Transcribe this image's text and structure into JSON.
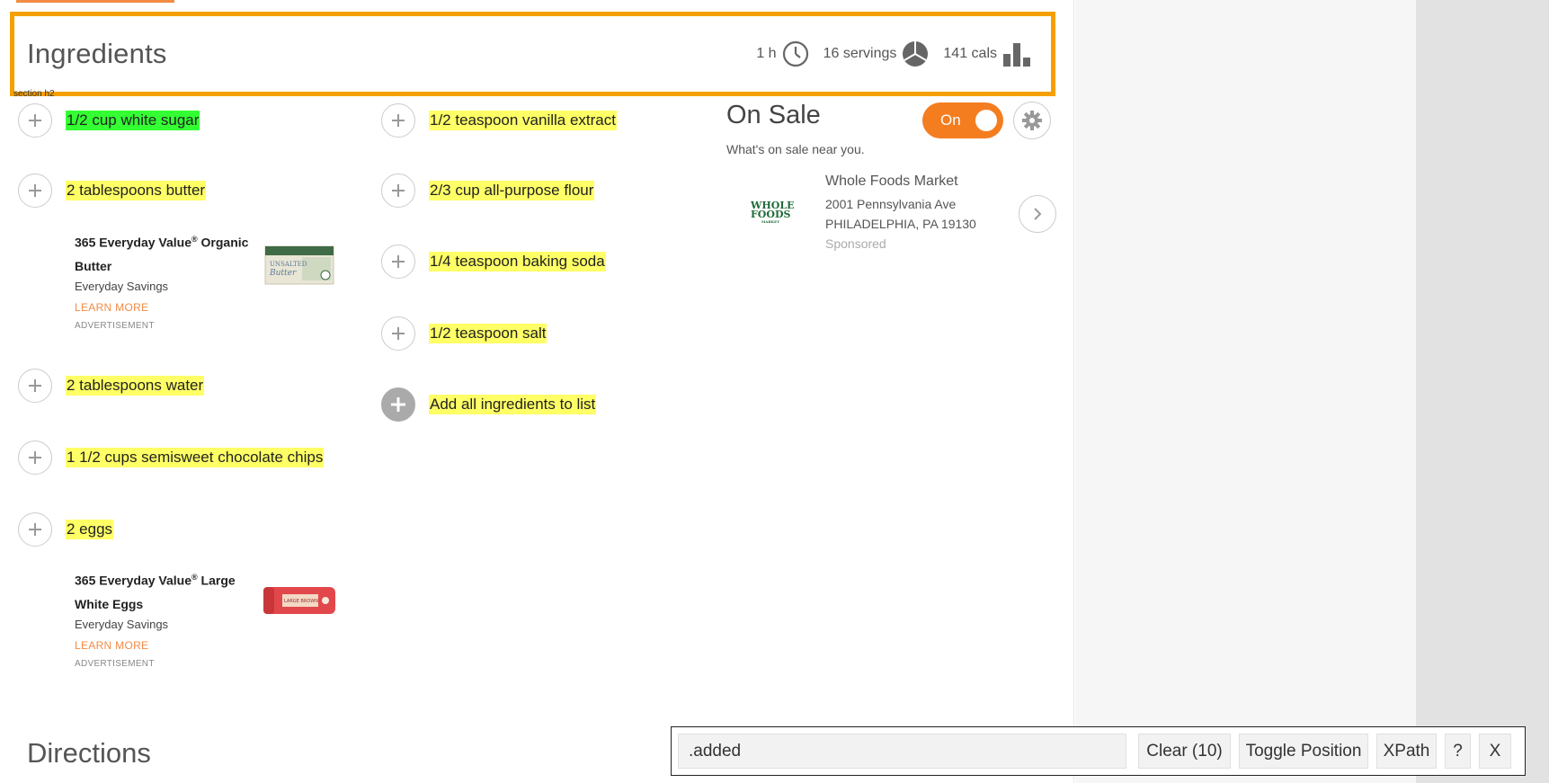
{
  "ingredients": {
    "title": "Ingredients",
    "meta": {
      "time": "1 h",
      "servings": "16 servings",
      "calories": "141 cals"
    },
    "section_tag": "section h2",
    "left_column": [
      {
        "text": "1/2 cup white sugar",
        "added": true
      },
      {
        "text": "2 tablespoons butter",
        "added": false
      },
      {
        "text": "2 tablespoons water",
        "added": false
      },
      {
        "text": "1 1/2 cups semisweet chocolate chips",
        "added": false
      },
      {
        "text": "2 eggs",
        "added": false
      }
    ],
    "right_column": [
      {
        "text": "1/2 teaspoon vanilla extract"
      },
      {
        "text": "2/3 cup all-purpose flour"
      },
      {
        "text": "1/4 teaspoon baking soda"
      },
      {
        "text": "1/2 teaspoon salt"
      }
    ],
    "add_all_label": "Add all ingredients to list"
  },
  "ads": [
    {
      "name": "365 Everyday Value",
      "reg": "®",
      "name_rest": " Organic Butter",
      "sub": "Everyday Savings",
      "learn": "LEARN MORE",
      "tag": "ADVERTISEMENT",
      "image_label": "UNSALTED Butter"
    },
    {
      "name": "365 Everyday Value",
      "reg": "®",
      "name_rest": " Large White Eggs",
      "sub": "Everyday Savings",
      "learn": "LEARN MORE",
      "tag": "ADVERTISEMENT",
      "image_label": "LARGE BROWN"
    }
  ],
  "on_sale": {
    "title": "On Sale",
    "subtitle": "What's on sale near you.",
    "toggle_label": "On",
    "store": {
      "logo_line1": "WHOLE",
      "logo_line2": "FOODS",
      "logo_line3": "MARKET",
      "name": "Whole Foods Market",
      "address1": "2001 Pennsylvania Ave",
      "address2": "PHILADELPHIA, PA 19130",
      "sponsored": "Sponsored"
    }
  },
  "directions": {
    "title": "Directions"
  },
  "selector_toolbar": {
    "input_value": ".added",
    "clear_label": "Clear (10)",
    "toggle_label": "Toggle Position",
    "xpath_label": "XPath",
    "help_label": "?",
    "close_label": "X"
  },
  "colors": {
    "accent_orange": "#f47d20",
    "header_outline": "#f5a000",
    "highlight_yellow": "#ffff66",
    "highlight_green": "#33ff33"
  }
}
